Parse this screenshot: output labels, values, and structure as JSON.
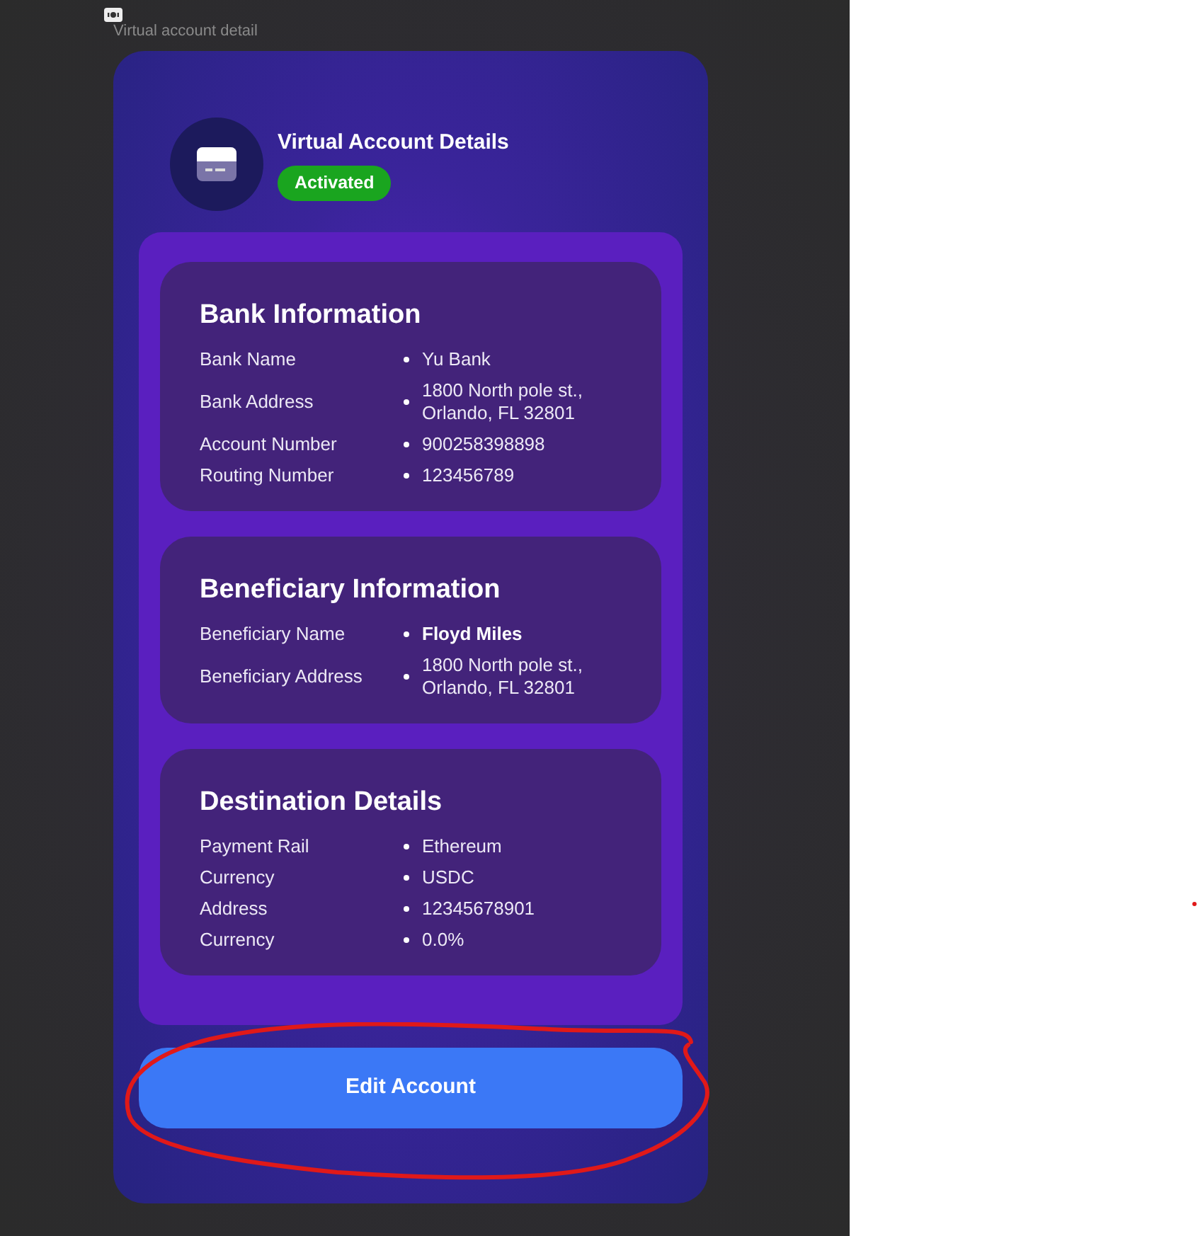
{
  "frame_label": "Virtual account detail",
  "header": {
    "title": "Virtual Account Details",
    "status": "Activated"
  },
  "sections": [
    {
      "title": "Bank Information",
      "rows": [
        {
          "label": "Bank Name",
          "value": "Yu Bank",
          "bold": false
        },
        {
          "label": "Bank Address",
          "value": "1800 North pole st., Orlando, FL 32801",
          "bold": false
        },
        {
          "label": "Account Number",
          "value": "900258398898",
          "bold": false
        },
        {
          "label": "Routing Number",
          "value": "123456789",
          "bold": false
        }
      ]
    },
    {
      "title": "Beneficiary Information",
      "rows": [
        {
          "label": "Beneficiary Name",
          "value": "Floyd Miles",
          "bold": true
        },
        {
          "label": "Beneficiary Address",
          "value": "1800 North pole st., Orlando, FL 32801",
          "bold": false
        }
      ]
    },
    {
      "title": "Destination Details",
      "rows": [
        {
          "label": "Payment Rail",
          "value": "Ethereum",
          "bold": false
        },
        {
          "label": "Currency",
          "value": "USDC",
          "bold": false
        },
        {
          "label": "Address",
          "value": "12345678901",
          "bold": false
        },
        {
          "label": "Currency",
          "value": "0.0%",
          "bold": false
        }
      ]
    }
  ],
  "button": "Edit Account"
}
